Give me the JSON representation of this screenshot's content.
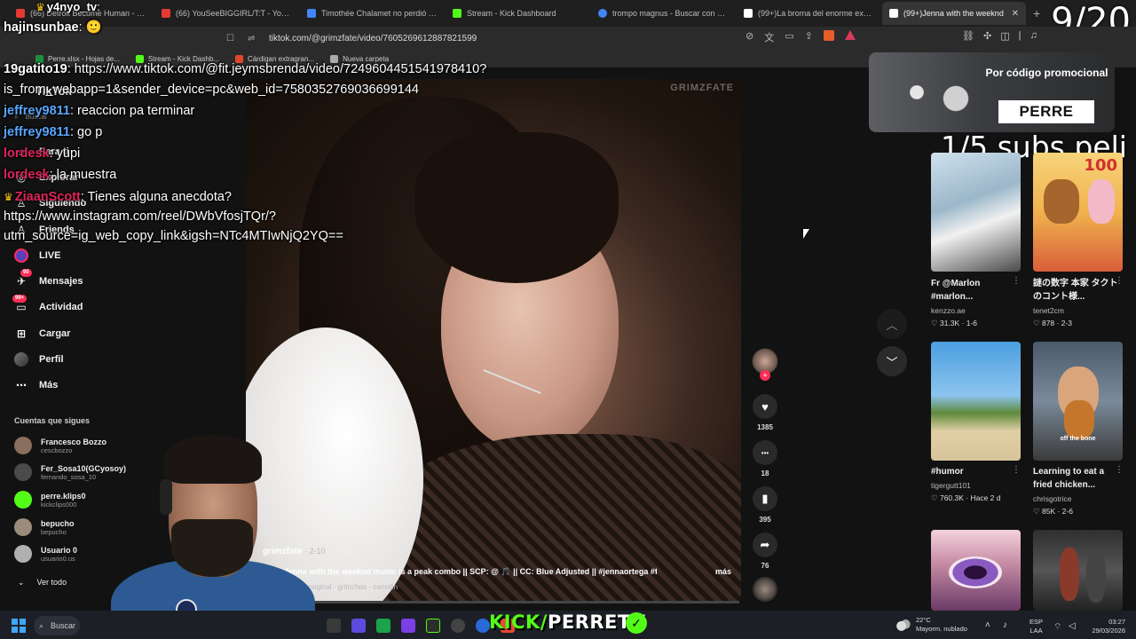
{
  "browser": {
    "tabs": [
      {
        "label": "(66) Detroit Become Human - Conne",
        "color": "#e53935"
      },
      {
        "label": "(66) YouSeeBIGGIRL/T:T - YouTube",
        "color": "#e53935"
      },
      {
        "label": "Timothée Chalamet no perdió el Oscar",
        "color": "#4285f4"
      },
      {
        "label": "Stream - Kick Dashboard",
        "color": "#53fc18"
      },
      {
        "label": "trompo magnus - Buscar con Google",
        "color": "#4285f4"
      },
      {
        "label": "(99+)La broma del enorme excremento",
        "color": "#ffffff"
      },
      {
        "label": "(99+)Jenna with the weeknd",
        "color": "#ffffff"
      }
    ],
    "new_tab": "+",
    "close": "✕",
    "url": "tiktok.com/@grimzfate/video/7605269612887821599",
    "bookmarks": [
      {
        "label": "Perre.xlsx - Hojas de...",
        "color": "#1e8e3e"
      },
      {
        "label": "Stream - Kick Dashb...",
        "color": "#53fc18"
      },
      {
        "label": "Cárdigan extragran...",
        "color": "#e0452f"
      },
      {
        "label": "Nueva carpeta",
        "color": "#aaaaaa"
      }
    ]
  },
  "stream": {
    "counter": "9/20",
    "subs_text": "1/5 subs peli",
    "chat": [
      {
        "user": "hajinsunbae",
        "text": ": 🙂",
        "color": "#ffffff",
        "crown": false
      },
      {
        "user": "y4nyo_tv",
        "text": ":",
        "color": "#ffffff",
        "crown": true
      },
      {
        "user": "19gatito19",
        "text": ": https://www.tiktok.com/@fit.jeymsbrenda/video/7249604451541978410?",
        "color": "#ffffff",
        "crown": true
      },
      {
        "user": "",
        "text": "is_from_webapp=1&sender_device=pc&web_id=7580352769036699144",
        "color": "#ffffff",
        "crown": false
      },
      {
        "user": "jeffrey9811",
        "text": ": reaccion pa terminar",
        "color": "#58a6ff",
        "crown": false
      },
      {
        "user": "jeffrey9811",
        "text": ": go p",
        "color": "#58a6ff",
        "crown": false
      },
      {
        "user": "lordesk",
        "text": ": yupi",
        "color": "#e0245e",
        "crown": false
      },
      {
        "user": "lordesk",
        "text": ": la muestra",
        "color": "#e0245e",
        "crown": false
      },
      {
        "user": "ZiaanScott",
        "text": ": Tienes alguna anecdota?",
        "color": "#e0245e",
        "crown": true
      },
      {
        "user": "",
        "text": "https://www.instagram.com/reel/DWbVfosjTQr/?",
        "color": "#ffffff",
        "crown": false
      },
      {
        "user": "",
        "text": "utm_source=ig_web_copy_link&igsh=NTc4MTIwNjQ2YQ==",
        "color": "#ffffff",
        "crown": false
      }
    ],
    "kick_prefix": "KICK/",
    "kick_name": "PERRETV",
    "verified": "✓"
  },
  "tiktok": {
    "brand": "TikTok",
    "search_placeholder": "Buscar",
    "nav": [
      {
        "label": "Para ti",
        "icon": "home-icon",
        "glyph": "⌂"
      },
      {
        "label": "Explorar",
        "icon": "compass-icon",
        "glyph": "◎"
      },
      {
        "label": "Siguiendo",
        "icon": "following-icon",
        "glyph": "♙"
      },
      {
        "label": "Friends",
        "icon": "friends-icon",
        "glyph": "♙"
      },
      {
        "label": "LIVE",
        "icon": "live-icon",
        "glyph": ""
      },
      {
        "label": "Mensajes",
        "icon": "messages-icon",
        "glyph": "✈",
        "badge": "90"
      },
      {
        "label": "Actividad",
        "icon": "activity-icon",
        "glyph": "▭",
        "badge": "99+"
      },
      {
        "label": "Cargar",
        "icon": "upload-icon",
        "glyph": "⊞"
      },
      {
        "label": "Perfil",
        "icon": "profile-icon",
        "glyph": "●"
      },
      {
        "label": "Más",
        "icon": "more-icon",
        "glyph": "⋯"
      }
    ],
    "following_title": "Cuentas que sigues",
    "following": [
      {
        "name": "Francesco Bozzo",
        "handle": "cescbozzo",
        "color": "#8a6e5e"
      },
      {
        "name": "Fer_Sosa10(GCyosoy)",
        "handle": "fernando_sosa_10",
        "color": "#4a4a4a"
      },
      {
        "name": "perre.klips0",
        "handle": "kickclips000",
        "color": "#53fc18"
      },
      {
        "name": "bepucho",
        "handle": "bepucho",
        "color": "#9b8b7b"
      },
      {
        "name": "Usuario 0",
        "handle": "usuario0.us",
        "color": "#b0b0b0"
      }
    ],
    "see_all": "Ver todo",
    "video": {
      "watermark": "GRIMZFATE",
      "author": "grimzfate",
      "date": " · 2-10",
      "description": "Jenna with the weeknd music is a peak combo || SCP: @ 🎵 || CC: Blue Adjusted || #jennaortega #fyp ...",
      "more": "más",
      "music": "Música original - grimzfate · canción",
      "progress": 0.0
    },
    "actions": [
      {
        "name": "like",
        "glyph": "♥",
        "count": "1385"
      },
      {
        "name": "comment",
        "glyph": "•••",
        "count": "18"
      },
      {
        "name": "save",
        "glyph": "▮",
        "count": "395"
      },
      {
        "name": "share",
        "glyph": "➦",
        "count": "76"
      }
    ],
    "promo": {
      "title": "Por código promocional",
      "code": "PERRE"
    },
    "cards": [
      {
        "title": "Fr @Marlon #marlon...",
        "user": "kenzzo.ae",
        "stats": "♡ 31.3K · 1-6"
      },
      {
        "title": "謎の数字 本家 タクトのコント様...",
        "user": "tenet2cm",
        "stats": "♡ 878 · 2-3"
      },
      {
        "title": "#humor",
        "user": "tigergutt101",
        "stats": "♡ 760.3K · Hace 2 d"
      },
      {
        "title": "Learning to eat a fried chicken...",
        "user": "chrisgotrice",
        "stats": "♡ 85K · 2-6"
      }
    ],
    "thumb_labels": {
      "t2": "100",
      "t4": "off the bone"
    }
  },
  "taskbar": {
    "search": "Buscar",
    "temp": "22°C",
    "weather": "Mayorm. nublado",
    "lang1": "ESP",
    "lang2": "LAA",
    "time": "03:27",
    "date": "29/03/2026"
  }
}
